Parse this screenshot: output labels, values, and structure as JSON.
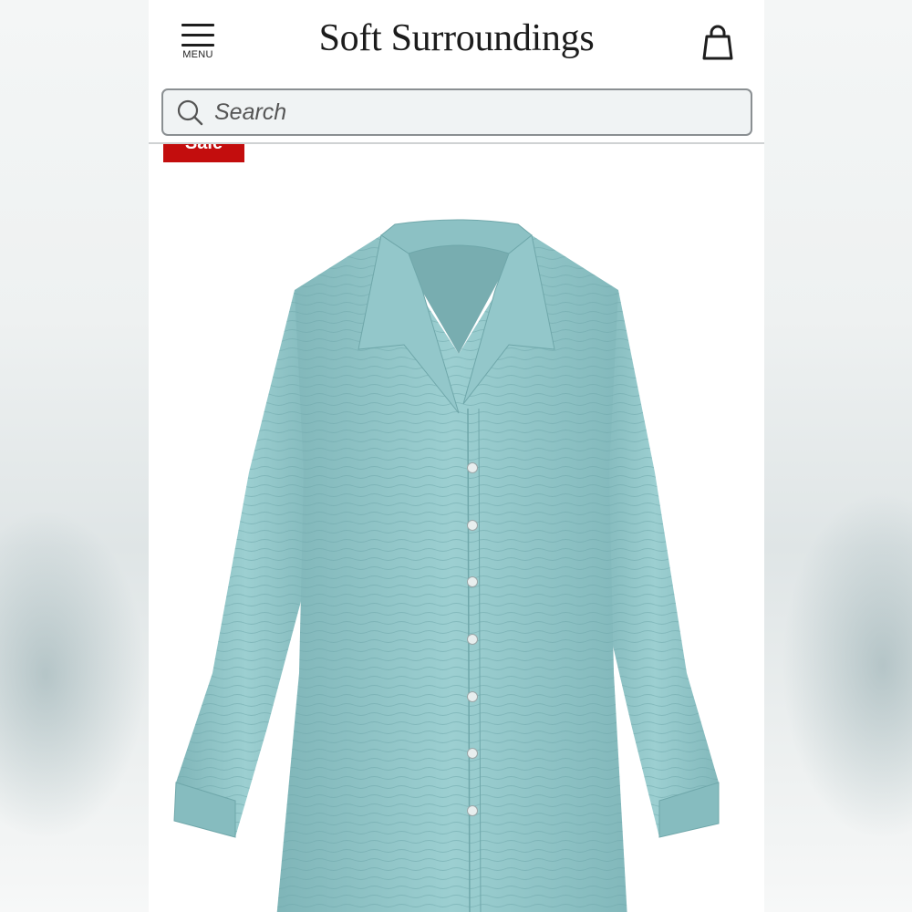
{
  "header": {
    "menu_label": "MENU",
    "brand": "Soft Surroundings",
    "menu_icon": "hamburger-menu-icon",
    "bag_icon": "shopping-bag-icon"
  },
  "search": {
    "placeholder": "Search",
    "icon": "search-icon"
  },
  "product": {
    "badge": "Sale",
    "image": "teal gauze button-front long-sleeve shirt",
    "colors": {
      "badge": "#c30d0d",
      "shirt": "#8fc3c6"
    }
  }
}
